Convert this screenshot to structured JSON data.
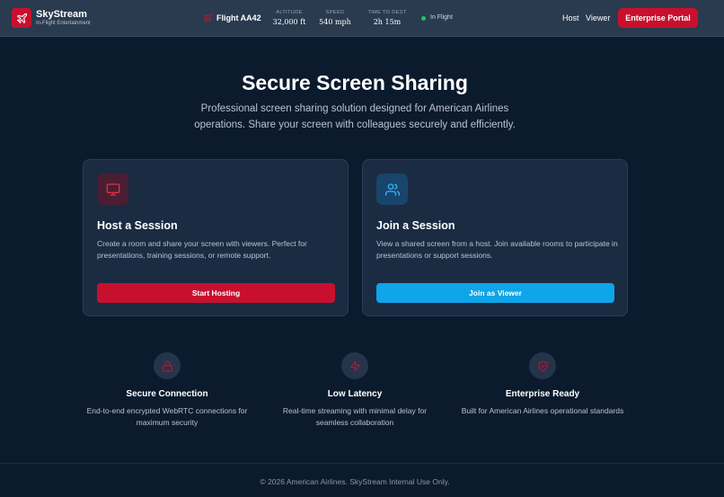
{
  "header": {
    "brand": "SkyStream",
    "brand_sub": "In-Flight Entertainment",
    "flight": "Flight AA42",
    "stats": [
      {
        "label": "ALTITUDE",
        "value": "32,000 ft"
      },
      {
        "label": "SPEED",
        "value": "540 mph"
      },
      {
        "label": "TIME TO DEST",
        "value": "2h 15m"
      }
    ],
    "status": "In Flight",
    "nav": {
      "host": "Host",
      "viewer": "Viewer"
    },
    "portal_button": "Enterprise Portal",
    "icons": {
      "logo": "airplane-icon",
      "flight": "airplane-icon"
    }
  },
  "hero": {
    "title": "Secure Screen Sharing",
    "subtitle": "Professional screen sharing solution designed for American Airlines operations. Share your screen with colleagues securely and efficiently."
  },
  "cards": {
    "host": {
      "icon": "monitor-icon",
      "title": "Host a Session",
      "desc": "Create a room and share your screen with viewers. Perfect for presentations, training sessions, or remote support.",
      "button": "Start Hosting"
    },
    "join": {
      "icon": "users-icon",
      "title": "Join a Session",
      "desc": "View a shared screen from a host. Join available rooms to participate in presentations or support sessions.",
      "button": "Join as Viewer"
    }
  },
  "features": [
    {
      "icon": "lock-icon",
      "title": "Secure Connection",
      "desc": "End-to-end encrypted WebRTC connections for maximum security"
    },
    {
      "icon": "lightning-icon",
      "title": "Low Latency",
      "desc": "Real-time streaming with minimal delay for seamless collaboration"
    },
    {
      "icon": "shield-icon",
      "title": "Enterprise Ready",
      "desc": "Built for American Airlines operational standards"
    }
  ],
  "footer": "© 2026 American Airlines. SkyStream Internal Use Only.",
  "colors": {
    "background": "#0c1a2e",
    "header": "#2a3a4f",
    "card": "#1b2b42",
    "accent_red": "#c8102e",
    "accent_blue": "#0ea5e9",
    "status_green": "#22c55e"
  }
}
